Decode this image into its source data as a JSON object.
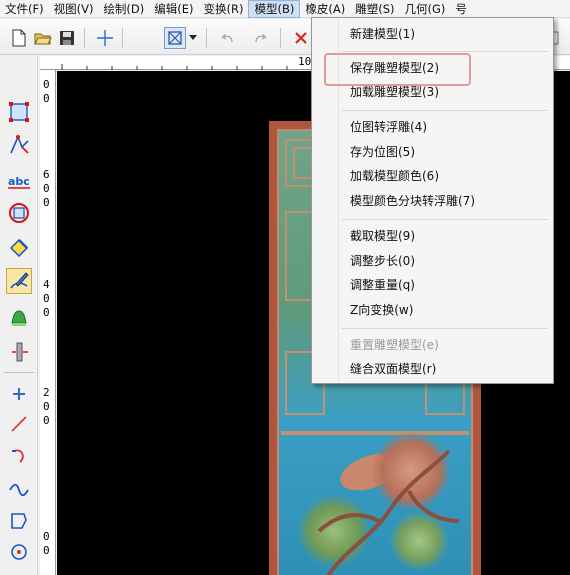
{
  "menubar": {
    "items": [
      "文件(F)",
      "视图(V)",
      "绘制(D)",
      "编辑(E)",
      "变换(R)",
      "模型(B)",
      "橡皮(A)",
      "雕塑(S)",
      "几何(G)",
      "号"
    ],
    "active_index": 5
  },
  "ruler": {
    "top_label": "10",
    "left_labels": [
      "0",
      "0",
      "6",
      "0",
      "0",
      "4",
      "0",
      "0",
      "2",
      "0",
      "0",
      "0",
      "0"
    ]
  },
  "model_menu": {
    "groups": [
      [
        {
          "label": "新建模型(1)",
          "enabled": true
        }
      ],
      [
        {
          "label": "保存雕塑模型(2)",
          "enabled": true,
          "highlighted": true
        },
        {
          "label": "加载雕塑模型(3)",
          "enabled": true
        }
      ],
      [
        {
          "label": "位图转浮雕(4)",
          "enabled": true
        },
        {
          "label": "存为位图(5)",
          "enabled": true
        },
        {
          "label": "加载模型颜色(6)",
          "enabled": true
        },
        {
          "label": "模型颜色分块转浮雕(7)",
          "enabled": true
        }
      ],
      [
        {
          "label": "截取模型(9)",
          "enabled": true
        },
        {
          "label": "调整步长(0)",
          "enabled": true
        },
        {
          "label": "调整重量(q)",
          "enabled": true
        },
        {
          "label": "Z向变换(w)",
          "enabled": true
        }
      ],
      [
        {
          "label": "重置雕塑模型(e)",
          "enabled": false
        },
        {
          "label": "缝合双面模型(r)",
          "enabled": true
        }
      ]
    ]
  },
  "colors": {
    "canvas_bg": "#000000",
    "panel_frame": "#b0563e",
    "panel_jade": "#5f9a7c",
    "panel_sky": "#2e8fb6",
    "menu_highlight_box": "#e59a9a",
    "active_menu_bg": "#cfe0f5"
  },
  "icons": {
    "toolbar": [
      "new-file-icon",
      "open-folder-icon",
      "save-icon",
      "crosshair-icon",
      "select-box-icon",
      "dropdown-arrow-icon",
      "undo-icon",
      "redo-icon",
      "delete-icon"
    ],
    "toolbox": [
      "select-node-icon",
      "node-edit-icon",
      "text-icon",
      "circle-target-icon",
      "eraser-icon",
      "sculpt-brush-icon",
      "bell-shape-icon",
      "measure-icon",
      "plus-point-icon",
      "line-icon",
      "arc-icon",
      "curve-icon",
      "polygon-icon",
      "circle-icon"
    ]
  }
}
